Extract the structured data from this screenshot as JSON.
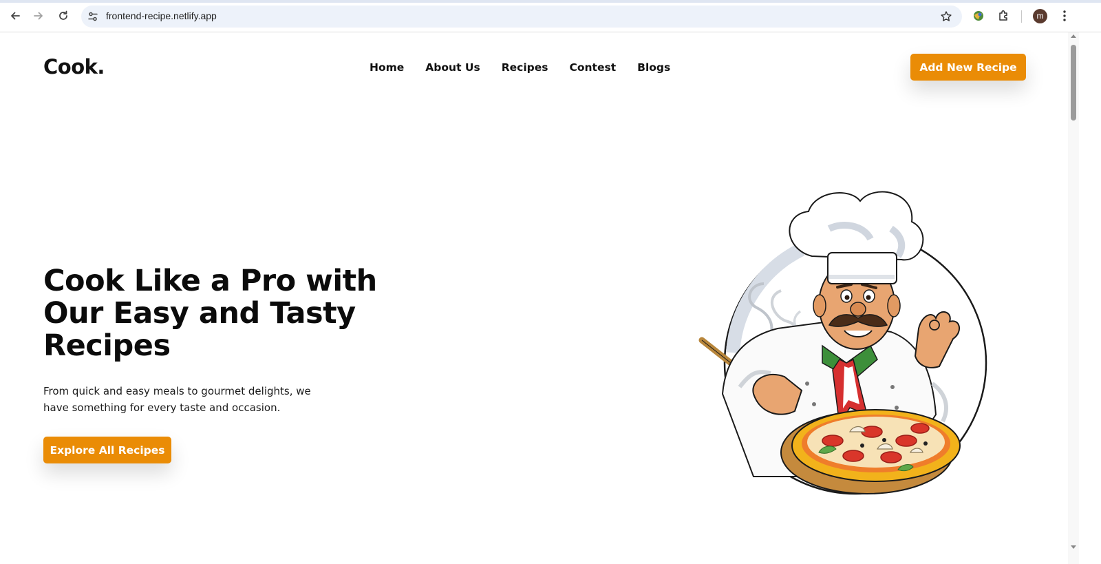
{
  "browser": {
    "url": "frontend-recipe.netlify.app",
    "profile_initial": "m"
  },
  "site": {
    "brand": "Cook.",
    "nav": [
      {
        "label": "Home"
      },
      {
        "label": "About Us"
      },
      {
        "label": "Recipes"
      },
      {
        "label": "Contest"
      },
      {
        "label": "Blogs"
      }
    ],
    "add_recipe_label": "Add New Recipe"
  },
  "hero": {
    "title": "Cook Like a Pro with Our Easy and Tasty Recipes",
    "text": "From quick and easy meals to gourmet delights, we have something for every taste and occasion.",
    "button_label": "Explore All Recipes"
  },
  "colors": {
    "accent": "#ea8c06",
    "text": "#111111"
  },
  "icons": [
    "back-arrow-icon",
    "forward-arrow-icon",
    "reload-icon",
    "site-info-icon",
    "bookmark-star-icon",
    "extension-icon",
    "puzzle-icon",
    "more-vert-icon"
  ]
}
